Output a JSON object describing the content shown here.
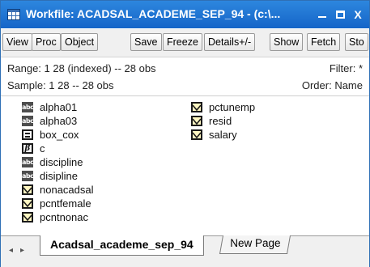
{
  "window": {
    "title": "Workfile: ACADSAL_ACADEME_SEP_94 - (c:\\...",
    "controls": {
      "minimize": "_",
      "close": "X"
    }
  },
  "toolbar": {
    "buttons": [
      "View",
      "Proc",
      "Object",
      "Save",
      "Freeze",
      "Details+/-",
      "Show",
      "Fetch",
      "Sto"
    ]
  },
  "info": {
    "range": "Range:  1 28 (indexed)  --  28 obs",
    "filter": "Filter: *",
    "sample": "Sample: 1 28  --  28 obs",
    "order": "Order: Name"
  },
  "objects": {
    "column1": [
      {
        "name": "alpha01",
        "icon": "alpha-icon"
      },
      {
        "name": "alpha03",
        "icon": "alpha-icon"
      },
      {
        "name": "box_cox",
        "icon": "vector-icon"
      },
      {
        "name": "c",
        "icon": "coefficient-icon"
      },
      {
        "name": "discipline",
        "icon": "alpha-icon"
      },
      {
        "name": "disipline",
        "icon": "alpha-icon"
      },
      {
        "name": "nonacadsal",
        "icon": "series-icon"
      },
      {
        "name": "pcntfemale",
        "icon": "series-icon"
      },
      {
        "name": "pcntnonac",
        "icon": "series-icon"
      }
    ],
    "column2": [
      {
        "name": "pctunemp",
        "icon": "series-icon"
      },
      {
        "name": "resid",
        "icon": "series-icon"
      },
      {
        "name": "salary",
        "icon": "series-icon"
      }
    ],
    "alpha_icon_text": "abc",
    "coef_icon_text": "β"
  },
  "tabs": {
    "nav_prev": "◂",
    "nav_next": "▸",
    "active": "Acadsal_academe_sep_94",
    "other": "New Page"
  },
  "colors": {
    "titlebar": "#1f78d1",
    "series_icon_fill": "#fff7c2"
  }
}
